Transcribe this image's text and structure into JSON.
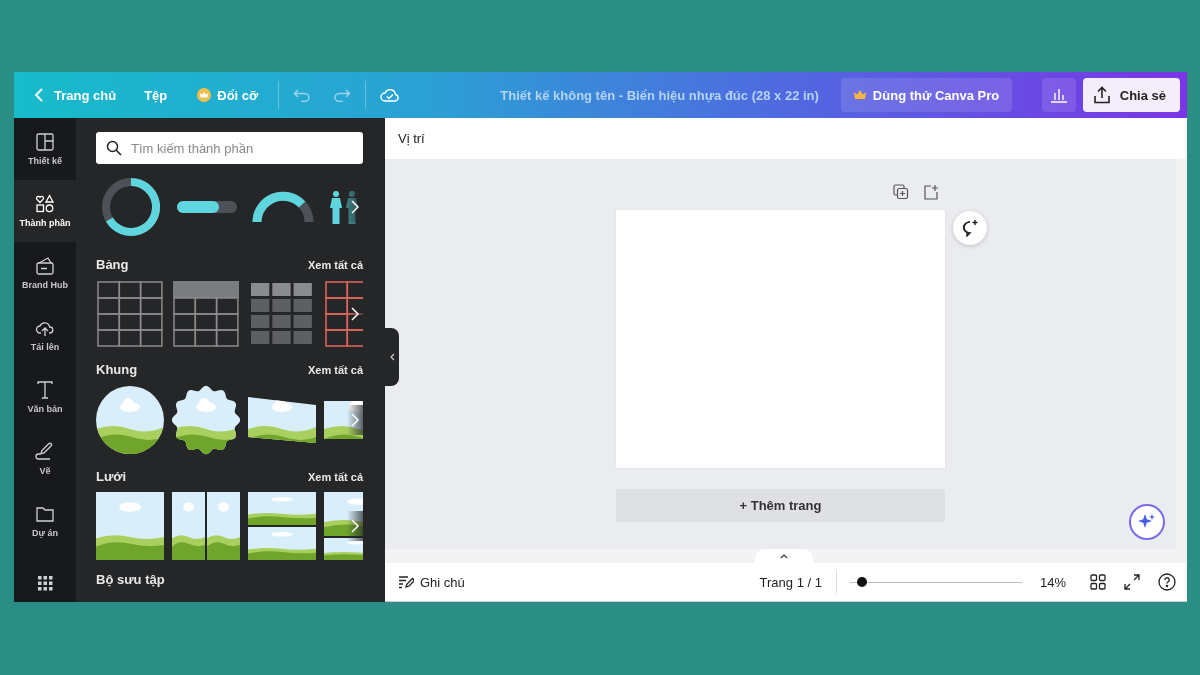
{
  "topbar": {
    "back": "Trang chủ",
    "file": "Tệp",
    "resize": "Đổi cỡ",
    "title": "Thiết kế không tên - Biển hiệu nhựa đúc (28 x 22 in)",
    "pro": "Dùng thử Canva Pro",
    "share": "Chia sẻ"
  },
  "sidebar": {
    "items": [
      {
        "kind": "layout",
        "label": "Thiết kế",
        "selected": false
      },
      {
        "kind": "shapes",
        "label": "Thành phần",
        "selected": true
      },
      {
        "kind": "brand",
        "label": "Brand Hub",
        "selected": false
      },
      {
        "kind": "upload",
        "label": "Tải lên",
        "selected": false
      },
      {
        "kind": "text",
        "label": "Văn bản",
        "selected": false
      },
      {
        "kind": "draw",
        "label": "Vẽ",
        "selected": false
      },
      {
        "kind": "folder",
        "label": "Dự án",
        "selected": false
      },
      {
        "kind": "apps",
        "selected": false
      }
    ]
  },
  "panel": {
    "search": {
      "placeholder": "Tìm kiếm thành phần"
    },
    "charts": [
      {
        "kind": "donut"
      },
      {
        "kind": "progress"
      },
      {
        "kind": "gauge"
      },
      {
        "kind": "people"
      }
    ],
    "sections": [
      {
        "kind": "tables",
        "title": "Bảng",
        "see_all": "Xem tất cả",
        "items": [
          {
            "kind": "lines"
          },
          {
            "kind": "header"
          },
          {
            "kind": "blocks"
          },
          {
            "kind": "red"
          }
        ]
      },
      {
        "kind": "frames",
        "title": "Khung",
        "see_all": "Xem tất cả",
        "items": [
          {
            "kind": "circle"
          },
          {
            "kind": "scallop"
          },
          {
            "kind": "skew"
          },
          {
            "kind": "rect"
          }
        ]
      },
      {
        "kind": "grids",
        "title": "Lưới",
        "see_all": "Xem tất cả",
        "items": [
          {
            "kind": "single"
          },
          {
            "kind": "columns"
          },
          {
            "kind": "rows"
          },
          {
            "kind": "mixed"
          }
        ]
      }
    ],
    "next_section": "Bộ sưu tập"
  },
  "canvas": {
    "position": "Vị trí",
    "add_page": "+ Thêm trang"
  },
  "footer": {
    "notes": "Ghi chú",
    "page": "Trang 1 / 1",
    "zoom": {
      "level": 0.07
    },
    "zoom_reading": "14%"
  }
}
